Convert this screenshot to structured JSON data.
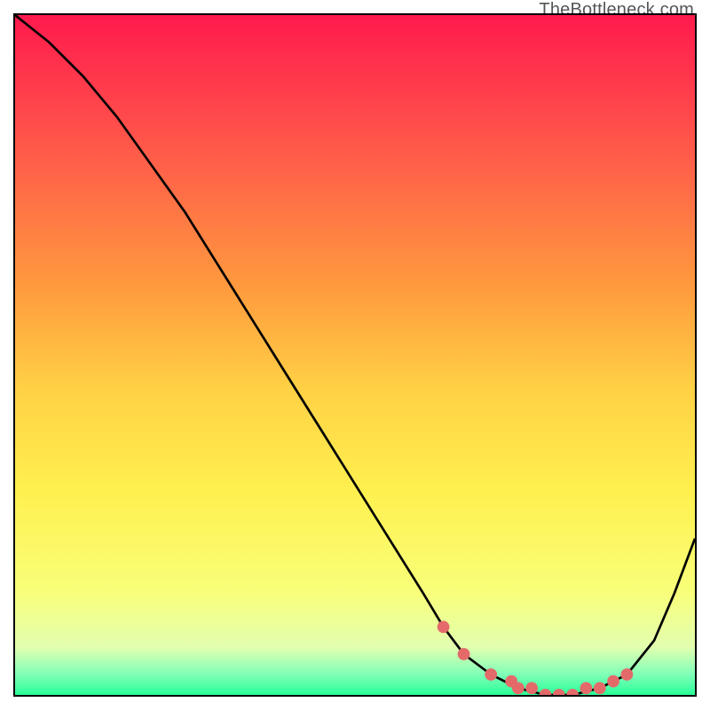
{
  "watermark": "TheBottleneck.com",
  "chart_data": {
    "type": "line",
    "title": "",
    "xlabel": "",
    "ylabel": "",
    "xlim": [
      0,
      100
    ],
    "ylim": [
      0,
      100
    ],
    "grid": false,
    "legend": false,
    "series": [
      {
        "name": "curve",
        "color": "#000000",
        "x": [
          0,
          5,
          10,
          15,
          20,
          25,
          30,
          35,
          40,
          45,
          50,
          55,
          60,
          63,
          66,
          70,
          74,
          78,
          82,
          86,
          90,
          94,
          97,
          100
        ],
        "y": [
          100,
          96,
          91,
          85,
          78,
          71,
          63,
          55,
          47,
          39,
          31,
          23,
          15,
          10,
          6,
          3,
          1,
          0,
          0,
          1,
          3,
          8,
          15,
          23
        ]
      },
      {
        "name": "highlight-dots",
        "color": "#e46a6a",
        "x": [
          63,
          66,
          70,
          73,
          74,
          76,
          78,
          80,
          82,
          84,
          86,
          88,
          90
        ],
        "y": [
          10,
          6,
          3,
          2,
          1,
          1,
          0,
          0,
          0,
          1,
          1,
          2,
          3
        ]
      }
    ],
    "background_gradient": {
      "stops": [
        {
          "pos": 0.0,
          "color": "#ff1a4d"
        },
        {
          "pos": 0.2,
          "color": "#ff5a4a"
        },
        {
          "pos": 0.4,
          "color": "#ff9a3e"
        },
        {
          "pos": 0.55,
          "color": "#ffd145"
        },
        {
          "pos": 0.7,
          "color": "#fff04f"
        },
        {
          "pos": 0.85,
          "color": "#f8ff7a"
        },
        {
          "pos": 0.93,
          "color": "#e2ffb0"
        },
        {
          "pos": 0.97,
          "color": "#7fffb8"
        },
        {
          "pos": 1.0,
          "color": "#29ff98"
        }
      ]
    }
  }
}
